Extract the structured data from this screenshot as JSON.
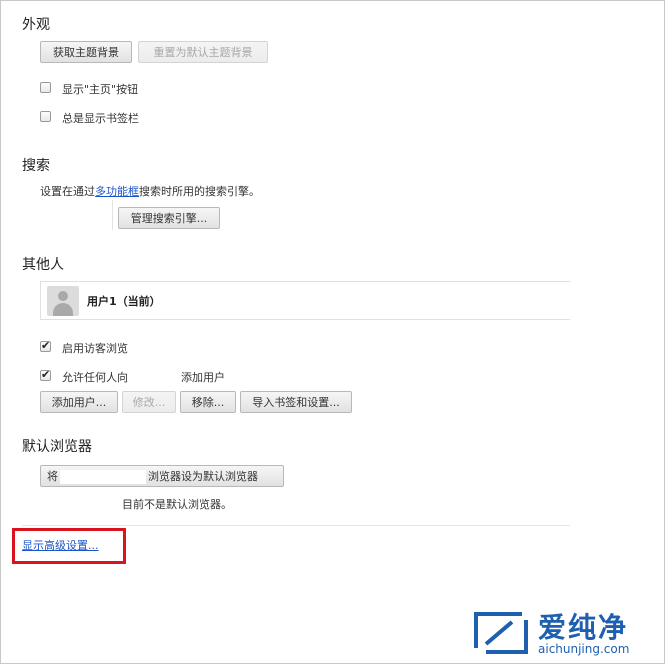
{
  "appearance": {
    "heading": "外观",
    "get_theme_button": "获取主题背景",
    "reset_theme_button": "重置为默认主题背景",
    "show_home_label": "显示\"主页\"按钮",
    "show_bookmarks_label": "总是显示书签栏"
  },
  "search": {
    "heading": "搜索",
    "desc_prefix": "设置在通过",
    "desc_link": "多功能框",
    "desc_suffix": "搜索时所用的搜索引擎。",
    "manage_button": "管理搜索引擎..."
  },
  "people": {
    "heading": "其他人",
    "user_name": "用户1（当前）",
    "guest_label": "启用访客浏览",
    "allow_add_label": "允许任何人向",
    "allow_add_suffix": "添加用户",
    "add_user_button": "添加用户...",
    "edit_button": "修改...",
    "remove_button": "移除...",
    "import_button": "导入书签和设置..."
  },
  "default_browser": {
    "heading": "默认浏览器",
    "set_default_prefix": "将",
    "set_default_suffix": "浏览器设为默认浏览器",
    "status": "目前不是默认浏览器。"
  },
  "advanced": {
    "link": "显示高级设置..."
  },
  "watermark": {
    "brand_cn": "爱纯净",
    "brand_url": "aichunjing.com"
  },
  "colors": {
    "highlight_box": "#d9141e",
    "link": "#1a55c9",
    "watermark_blue": "#1f5fb0"
  }
}
